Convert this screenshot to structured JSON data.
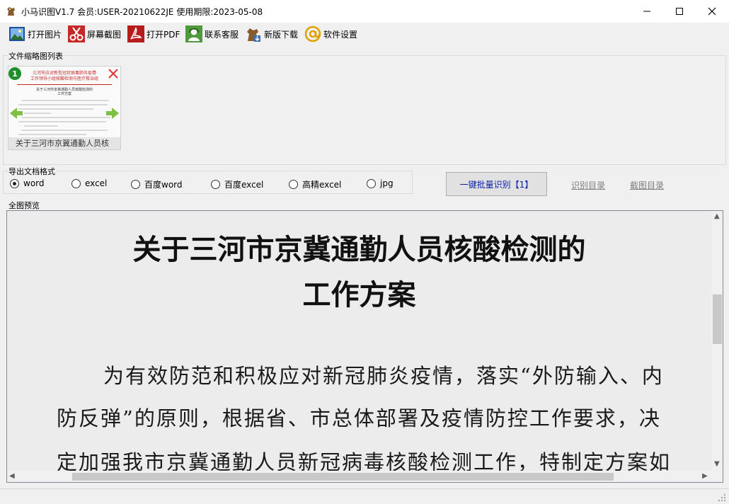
{
  "window": {
    "title": "小马识图V1.7  会员:USER-20210622JE 使用期限:2023-05-08",
    "minimize_glyph": "—",
    "maximize_glyph": "☐",
    "close_glyph": "✕"
  },
  "toolbar": {
    "items": [
      {
        "label": "打开图片",
        "icon": "open-image-icon"
      },
      {
        "label": "屏幕截图",
        "icon": "scissors-icon"
      },
      {
        "label": "打开PDF",
        "icon": "pdf-icon"
      },
      {
        "label": "联系客服",
        "icon": "support-icon"
      },
      {
        "label": "新版下载",
        "icon": "download-icon"
      },
      {
        "label": "软件设置",
        "icon": "settings-at-icon"
      }
    ]
  },
  "thumbnails": {
    "group_label": "文件缩略图列表",
    "items": [
      {
        "index": "1",
        "caption": "关于三河市京冀通勤人员核",
        "header_lines": [
          "三河市应对新型冠状病毒肺炎疫情",
          "工作领导小组核酸检测与医疗救治组"
        ],
        "doc_title_lines": [
          "关于三河市京冀通勤人员核酸检测的",
          "工作方案"
        ]
      }
    ]
  },
  "export_format": {
    "group_label": "导出文档格式",
    "options": [
      "word",
      "excel",
      "百度word",
      "百度excel",
      "高精excel",
      "jpg"
    ],
    "selected": "word"
  },
  "actions": {
    "batch_button": "一键批量识别【1】",
    "recognize_dir": "识别目录",
    "screenshot_dir": "截图目录"
  },
  "preview": {
    "group_label": "全图预览",
    "title_lines": [
      "关于三河市京冀通勤人员核酸检测的",
      "工作方案"
    ],
    "body_lines": [
      "为有效防范和积极应对新冠肺炎疫情，落实“外防输入、内",
      "防反弹”的原则，根据省、市总体部署及疫情防控工作要求，决",
      "定加强我市京冀通勤人员新冠病毒核酸检测工作，特制定方案如"
    ]
  }
}
